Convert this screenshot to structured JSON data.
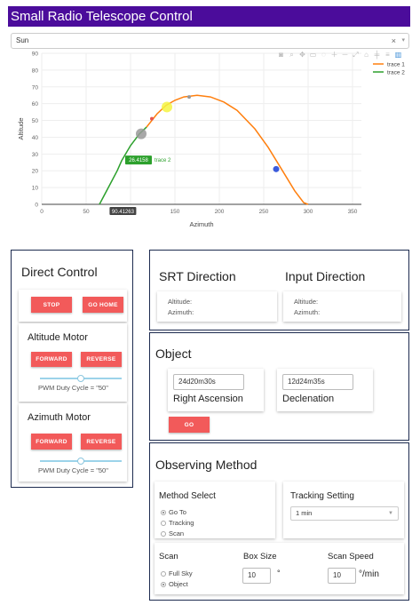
{
  "app": {
    "title": "Small Radio Telescope Control"
  },
  "target_select": {
    "value": "Sun",
    "clear_icon": "×",
    "caret_icon": "▾"
  },
  "plot": {
    "modebar_icons": [
      "camera-icon",
      "zoom-icon",
      "pan-icon",
      "box-select-icon",
      "lasso-icon",
      "zoom-in-icon",
      "zoom-out-icon",
      "autoscale-icon",
      "reset-icon",
      "spike-icon",
      "compare-icon",
      "plotly-logo-icon"
    ],
    "hover_x_label": "90.41263",
    "hover_y_label": "26.4158",
    "hover_trace_label": "trace 2"
  },
  "chart_data": {
    "type": "line",
    "xlabel": "Azimuth",
    "ylabel": "Altitude",
    "xlim": [
      0,
      360
    ],
    "ylim": [
      0,
      90
    ],
    "xticks": [
      0,
      50,
      100,
      150,
      200,
      250,
      300,
      350
    ],
    "yticks": [
      0,
      10,
      20,
      30,
      40,
      50,
      60,
      70,
      80,
      90
    ],
    "legend_position": "top-right",
    "colors": {
      "trace_1": "#ff7f0e",
      "trace_2": "#2ca02c"
    },
    "series": [
      {
        "name": "trace 1",
        "x": [
          118,
          130,
          140,
          150,
          160,
          175,
          190,
          205,
          220,
          240,
          255,
          270,
          285,
          295,
          300
        ],
        "y": [
          46,
          54,
          59,
          62,
          64,
          65,
          64,
          61,
          56,
          45,
          34,
          21,
          8,
          1,
          0
        ]
      },
      {
        "name": "trace 2",
        "x": [
          65,
          75,
          85,
          90,
          100,
          110,
          118
        ],
        "y": [
          0,
          10,
          20,
          26,
          35,
          42,
          46
        ]
      }
    ],
    "markers": [
      {
        "x": 141,
        "y": 58,
        "color": "#f4f442",
        "size": 6
      },
      {
        "x": 112,
        "y": 42,
        "color": "#999999",
        "size": 6
      },
      {
        "x": 124,
        "y": 51,
        "color": "#e8554e",
        "size": 2
      },
      {
        "x": 166,
        "y": 64,
        "color": "#999999",
        "size": 2
      },
      {
        "x": 264,
        "y": 21,
        "color": "#3b5bdb",
        "size": 3.5
      }
    ]
  },
  "direct_control": {
    "title": "Direct Control",
    "stop_label": "STOP",
    "gohome_label": "GO HOME",
    "altitude": {
      "title": "Altitude Motor",
      "forward_label": "FORWARD",
      "reverse_label": "REVERSE",
      "pwm_label": "PWM Duty Cycle = \"50\"",
      "pwm_value": 0.5
    },
    "azimuth": {
      "title": "Azimuth Motor",
      "forward_label": "FORWARD",
      "reverse_label": "REVERSE",
      "pwm_label": "PWM Duty Cycle = \"50\"",
      "pwm_value": 0.5
    }
  },
  "directions": {
    "srt": {
      "title": "SRT Direction",
      "altitude_label": "Altitude:",
      "azimuth_label": "Azimuth:"
    },
    "input": {
      "title": "Input Direction",
      "altitude_label": "Altitude:",
      "azimuth_label": "Azimuth:"
    }
  },
  "object": {
    "title": "Object",
    "ra_value": "24d20m30s",
    "ra_label": "Right Ascension",
    "dec_value": "12d24m35s",
    "dec_label": "Declenation",
    "go_label": "GO"
  },
  "observing": {
    "title": "Observing Method",
    "method_select": {
      "title": "Method Select",
      "options": [
        "Go To",
        "Tracking",
        "Scan"
      ],
      "selected": 0
    },
    "tracking": {
      "title": "Tracking Setting",
      "value": "1 min"
    },
    "scan": {
      "title": "Scan",
      "options": [
        "Full Sky",
        "Object"
      ],
      "selected": 1
    },
    "box_size": {
      "title": "Box Size",
      "value": "10",
      "unit": "°"
    },
    "scan_speed": {
      "title": "Scan Speed",
      "value": "10",
      "unit": "°/min"
    }
  }
}
